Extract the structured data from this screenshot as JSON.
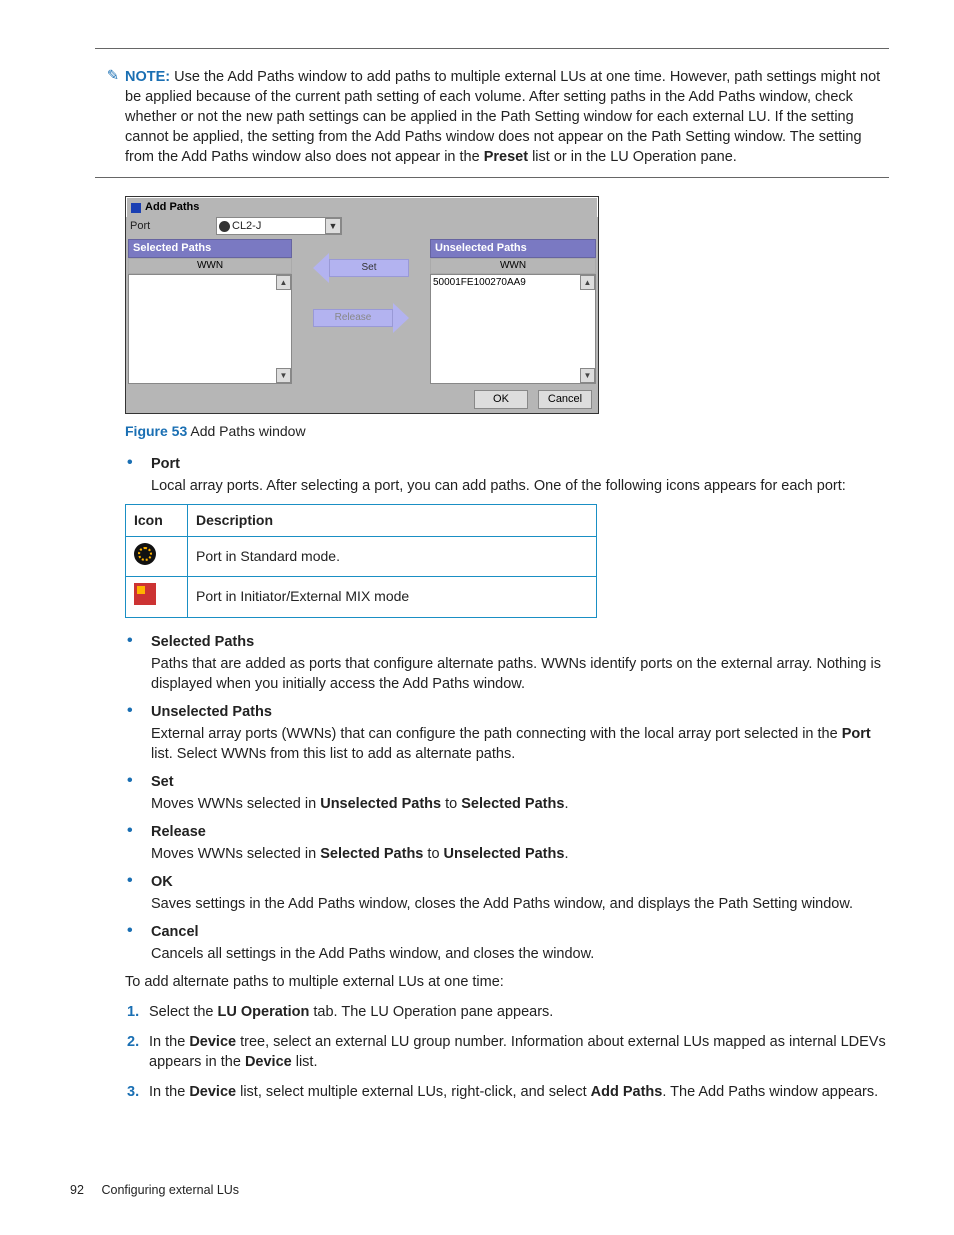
{
  "note": {
    "label": "NOTE:",
    "icon": "note-icon",
    "text_before_preset": "Use the Add Paths window to add paths to multiple external LUs at one time. However, path settings might not be applied because of the current path setting of each volume. After setting paths in the Add Paths window, check whether or not the new path settings can be applied in the Path Setting window for each external LU. If the setting cannot be applied, the setting from the Add Paths window does not appear on the Path Setting window. The setting from the Add Paths window also does not appear in the ",
    "preset_word": "Preset",
    "text_after_preset": " list or in the LU Operation pane."
  },
  "window": {
    "title": "Add Paths",
    "port_label": "Port",
    "port_value": "CL2-J",
    "selected_head": "Selected Paths",
    "unselected_head": "Unselected Paths",
    "col_wwn": "WWN",
    "row_wwn": "50001FE100270AA9",
    "set_btn": "Set",
    "release_btn": "Release",
    "ok_btn": "OK",
    "cancel_btn": "Cancel"
  },
  "figure": {
    "lead": "Figure 53",
    "text": "Add Paths window"
  },
  "items": {
    "port": {
      "term": "Port",
      "desc": "Local array ports. After selecting a port, you can add paths. One of the following icons appears for each port:"
    },
    "selected": {
      "term": "Selected Paths",
      "desc": "Paths that are added as ports that configure alternate paths. WWNs identify ports on the external array. Nothing is displayed when you initially access the Add Paths window."
    },
    "unselected": {
      "term": "Unselected Paths",
      "desc_1": "External array ports (WWNs) that can configure the path connecting with the local array port selected in the ",
      "desc_port": "Port",
      "desc_2": " list. Select WWNs from this list to add as alternate paths."
    },
    "set": {
      "term": "Set",
      "desc_1": "Moves WWNs selected in ",
      "desc_unp": "Unselected Paths",
      "desc_2": " to ",
      "desc_selp": "Selected Paths",
      "desc_3": "."
    },
    "release": {
      "term": "Release",
      "desc_1": "Moves WWNs selected in ",
      "desc_selp": "Selected Paths",
      "desc_2": " to ",
      "desc_unp": "Unselected Paths",
      "desc_3": "."
    },
    "ok": {
      "term": "OK",
      "desc": "Saves settings in the Add Paths window, closes the Add Paths window, and displays the Path Setting window."
    },
    "cancel": {
      "term": "Cancel",
      "desc": "Cancels all settings in the Add Paths window, and closes the window."
    }
  },
  "table": {
    "h_icon": "Icon",
    "h_desc": "Description",
    "r1": "Port in Standard mode.",
    "r2": "Port in Initiator/External MIX mode"
  },
  "lead_para": "To add alternate paths to multiple external LUs at one time:",
  "steps": {
    "s1_a": "Select the ",
    "s1_b": "LU Operation",
    "s1_c": " tab. The LU Operation pane appears.",
    "s2_a": "In the ",
    "s2_b": "Device",
    "s2_c": " tree, select an external LU group number. Information about external LUs mapped as internal LDEVs appears in the ",
    "s2_d": "Device",
    "s2_e": " list.",
    "s3_a": "In the ",
    "s3_b": "Device",
    "s3_c": " list, select multiple external LUs, right-click, and select ",
    "s3_d": "Add Paths",
    "s3_e": ". The Add Paths window appears."
  },
  "footer": {
    "page": "92",
    "title": "Configuring external LUs"
  }
}
